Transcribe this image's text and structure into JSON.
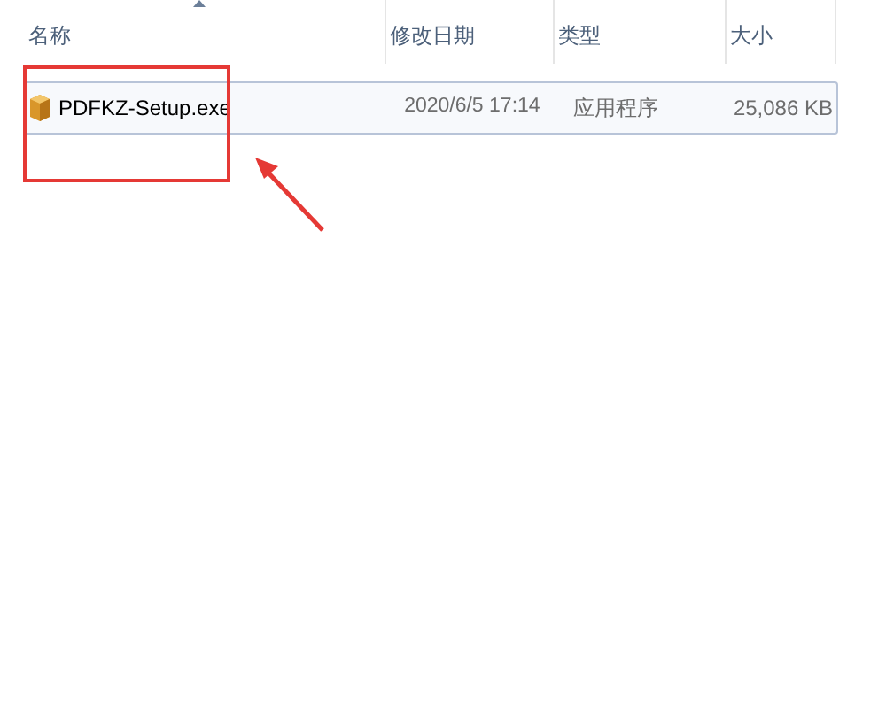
{
  "columns": [
    {
      "label": "名称",
      "sorted": true
    },
    {
      "label": "修改日期",
      "sorted": false
    },
    {
      "label": "类型",
      "sorted": false
    },
    {
      "label": "大小",
      "sorted": false
    }
  ],
  "rows": [
    {
      "name": "PDFKZ-Setup.exe",
      "date": "2020/6/5 17:14",
      "type": "应用程序",
      "size": "25,086 KB",
      "selected": true
    }
  ]
}
